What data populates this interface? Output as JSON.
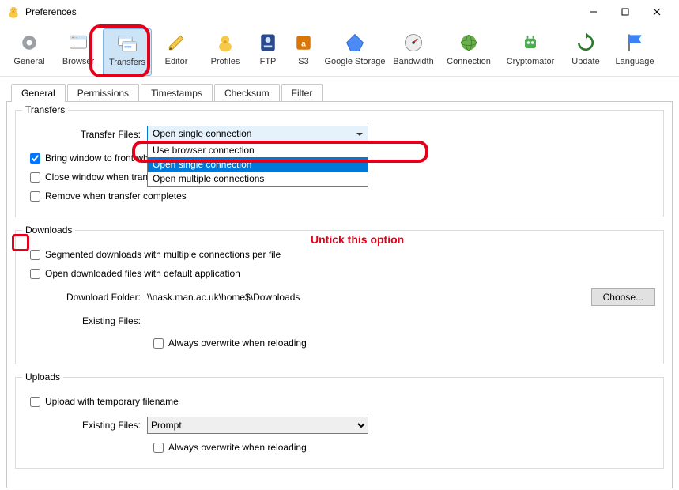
{
  "window": {
    "title": "Preferences"
  },
  "toolbar": {
    "general": "General",
    "browser": "Browser",
    "transfers": "Transfers",
    "editor": "Editor",
    "profiles": "Profiles",
    "ftp": "FTP",
    "s3": "S3",
    "google_storage": "Google Storage",
    "bandwidth": "Bandwidth",
    "connection": "Connection",
    "cryptomator": "Cryptomator",
    "update": "Update",
    "language": "Language"
  },
  "tabs": {
    "general": "General",
    "permissions": "Permissions",
    "timestamps": "Timestamps",
    "checksum": "Checksum",
    "filter": "Filter"
  },
  "transfers_group": {
    "caption": "Transfers",
    "transfer_files_label": "Transfer Files:",
    "transfer_files_value": "Open single connection",
    "transfer_files_options": {
      "use_browser": "Use browser connection",
      "single": "Open single connection",
      "multiple": "Open multiple connections"
    },
    "bring_front": "Bring window to front when transfer completes",
    "close_window": "Close window when transfer completes",
    "remove_complete": "Remove when transfer completes",
    "bring_front_checked": true,
    "close_window_checked": false,
    "remove_complete_checked": false
  },
  "downloads_group": {
    "caption": "Downloads",
    "segmented": "Segmented downloads with multiple connections per file",
    "segmented_checked": false,
    "open_after": "Open downloaded files with default application",
    "open_after_checked": false,
    "download_folder_label": "Download Folder:",
    "download_folder_value": "\\\\nask.man.ac.uk\\home$\\Downloads",
    "choose_btn": "Choose...",
    "existing_files_label": "Existing Files:",
    "always_overwrite_reload": "Always overwrite when reloading",
    "always_overwrite_reload_checked": false
  },
  "uploads_group": {
    "caption": "Uploads",
    "temp_filename": "Upload with temporary filename",
    "temp_filename_checked": false,
    "existing_files_label": "Existing Files:",
    "existing_files_value": "Prompt",
    "always_overwrite_reload": "Always overwrite when reloading",
    "always_overwrite_reload_checked": false
  },
  "annotations": {
    "untick": "Untick this option"
  }
}
